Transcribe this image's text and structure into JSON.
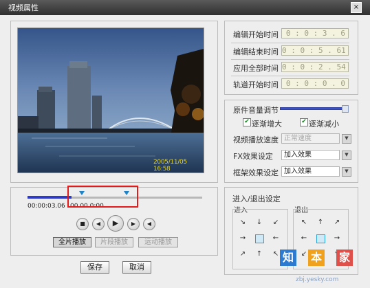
{
  "window": {
    "title": "视频属性",
    "close_glyph": "×"
  },
  "timing": {
    "rows": [
      {
        "label": "编辑开始时间",
        "value": "0 : 0 : 3 . 6"
      },
      {
        "label": "编辑结束时间",
        "value": "0 : 0 : 5 . 61"
      },
      {
        "label": "应用全部时间",
        "value": "0 : 0 : 2 . 54"
      },
      {
        "label": "轨道开始时间",
        "value": "0 : 0 : 0 . 0"
      }
    ]
  },
  "audio": {
    "volume_label": "原件音量调节",
    "volume_level": 0.95,
    "fade_in": {
      "label": "逐渐增大",
      "checked": true
    },
    "fade_out": {
      "label": "逐渐减小",
      "checked": true
    }
  },
  "effects": {
    "speed": {
      "label": "视频播放速度",
      "value": "正常速度",
      "disabled": true
    },
    "fx": {
      "label": "FX效果设定",
      "value": "加入效果"
    },
    "frame": {
      "label": "框架效果设定",
      "value": "加入效果"
    }
  },
  "video": {
    "timestamp": "2005/11/05  16:58"
  },
  "timeline": {
    "current_time": "00:00:03.06",
    "mark_label": "00 00  0:00",
    "progress": 0.25
  },
  "playback": {
    "stop_icon": "■",
    "prev_icon": "◀",
    "play_icon": "▶",
    "next_icon": "▶",
    "volume_icon": "◀"
  },
  "modes": {
    "full": "全片播放",
    "clip": "片段播放",
    "motion": "运动播放"
  },
  "transition": {
    "title": "进入/退出设定",
    "in_label": "进入",
    "out_label": "退出"
  },
  "arrows": {
    "nw": "↖",
    "n": "↑",
    "ne": "↗",
    "w": "←",
    "e": "→",
    "sw": "↙",
    "s": "↓",
    "se": "↘"
  },
  "buttons": {
    "save": "保存",
    "cancel": "取消"
  },
  "watermark": {
    "chars": [
      "知",
      "本",
      "家"
    ],
    "url": "zbj.yesky.com"
  },
  "colors": {
    "accent": "#2e3bc2",
    "highlight": "#e41a1a",
    "marker": "#1e83c7"
  }
}
